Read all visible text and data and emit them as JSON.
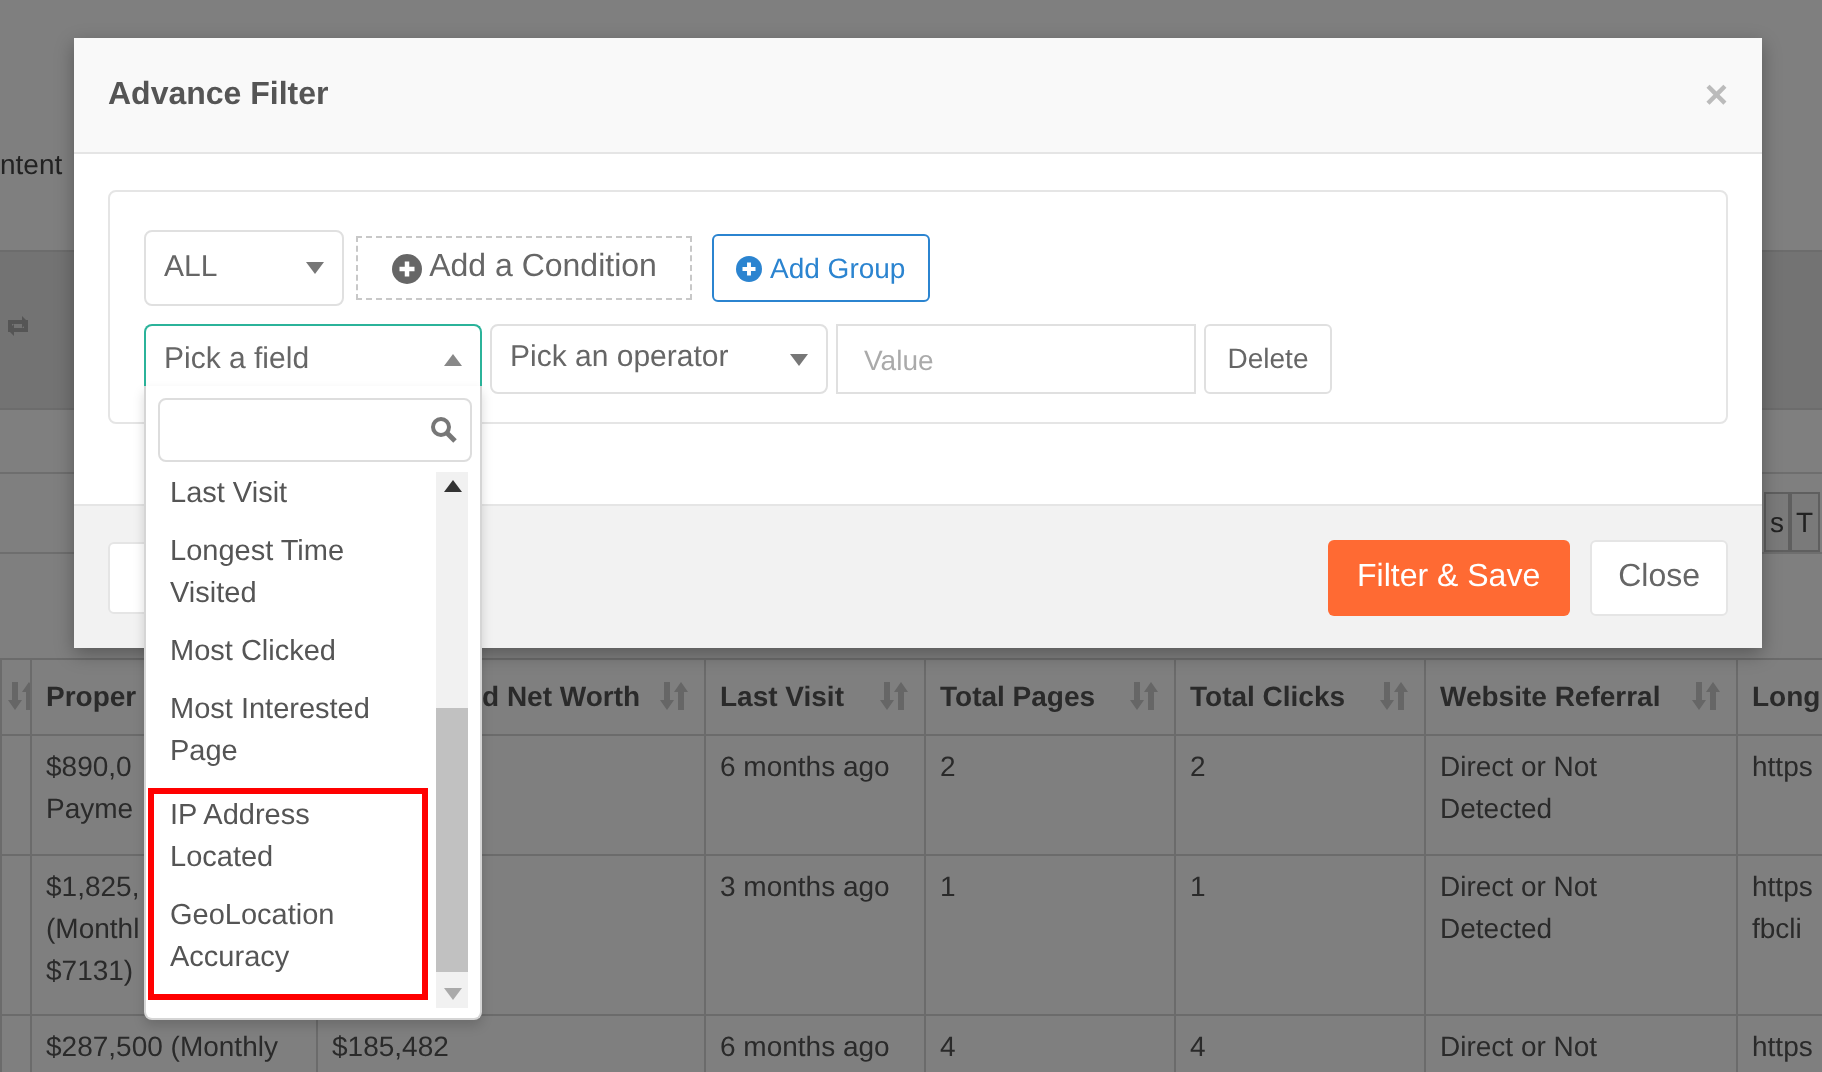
{
  "background": {
    "intro_text": "ntent",
    "side_tabs": [
      "s",
      "T"
    ],
    "table": {
      "columns": [
        {
          "label": "Proper",
          "sort_icon": false
        },
        {
          "label": "d Net Worth",
          "sort_icon": true
        },
        {
          "label": "Last Visit",
          "sort_icon": true
        },
        {
          "label": "Total Pages",
          "sort_icon": true
        },
        {
          "label": "Total Clicks",
          "sort_icon": true
        },
        {
          "label": "Website Referral",
          "sort_icon": true
        },
        {
          "label": "Long",
          "sort_icon": false
        }
      ],
      "rows": [
        {
          "cells": [
            "$890,0\nPayme",
            null,
            "6 months ago",
            "2",
            "2",
            "Direct or Not\nDetected",
            "https"
          ]
        },
        {
          "cells": [
            "$1,825,\n(Monthl\n$7131)",
            null,
            "3 months ago",
            "1",
            "1",
            "Direct or Not\nDetected",
            "https\nfbcli"
          ]
        },
        {
          "cells": [
            "$287,500 (Monthly",
            "$185,482",
            "6 months ago",
            "4",
            "4",
            "Direct or Not",
            "https"
          ]
        }
      ]
    }
  },
  "modal": {
    "title": "Advance Filter",
    "close": "×",
    "match_select": {
      "value": "ALL"
    },
    "add_condition": "Add a Condition",
    "add_group": "Add Group",
    "rule": {
      "field": {
        "placeholder": "Pick a field",
        "expanded": true
      },
      "operator": {
        "placeholder": "Pick an operator"
      },
      "value": {
        "placeholder": "Value"
      },
      "delete": "Delete"
    },
    "footer_buttons": [
      {
        "label": "Filter & Save",
        "kind": "primary"
      },
      {
        "label": "Close",
        "kind": "default"
      }
    ]
  },
  "field_dropdown": {
    "items": [
      {
        "label": "Last Visit",
        "highlighted": false
      },
      {
        "label": "Longest Time Visited",
        "highlighted": false
      },
      {
        "label": "Most Clicked",
        "highlighted": false
      },
      {
        "label": "Most Interested Page",
        "highlighted": false
      },
      {
        "label": "IP Address Located",
        "highlighted": true
      },
      {
        "label": "GeoLocation Accuracy",
        "highlighted": true
      }
    ]
  }
}
